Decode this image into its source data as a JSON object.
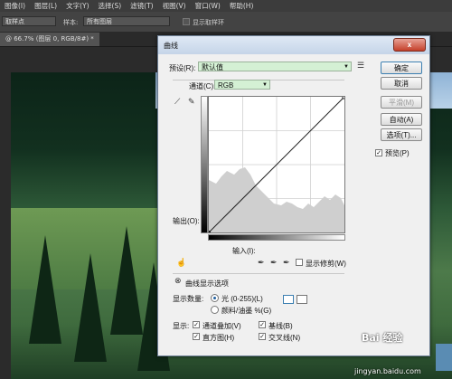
{
  "menu": [
    "图像(I)",
    "图层(L)",
    "文字(Y)",
    "选择(S)",
    "滤镜(T)",
    "视图(V)",
    "窗口(W)",
    "帮助(H)"
  ],
  "options": {
    "tool_select": "取样点",
    "sample_label": "样本:",
    "sample_value": "所有图层",
    "ring_label": "显示取样环"
  },
  "doc_tab": "@ 66.7% (图层 0, RGB/8#) *",
  "dialog": {
    "title": "曲线",
    "close": "x",
    "preset_label": "预设(R):",
    "preset_value": "默认值",
    "channel_label": "通道(C):",
    "channel_value": "RGB",
    "output_label": "输出(O):",
    "input_label": "输入(I):",
    "clip_label": "显示修剪(W)",
    "curve_options_label": "曲线显示选项",
    "show_amount_label": "显示数量:",
    "light_label": "光 (0-255)(L)",
    "pigment_label": "颜料/油墨 %(G)",
    "show_label": "显示:",
    "channel_overlay_label": "通道叠加(V)",
    "baseline_label": "基线(B)",
    "histogram_label": "直方图(H)",
    "intersection_label": "交叉线(N)",
    "buttons": {
      "ok": "确定",
      "cancel": "取消",
      "smooth": "平滑(M)",
      "auto": "自动(A)",
      "options": "选项(T)...",
      "preview": "预览(P)"
    }
  },
  "watermark": "Bai 经验",
  "watermark_url": "jingyan.baidu.com",
  "colors": {
    "combo_bg": "#d4f0d4",
    "title_bar": "#c5d5e8",
    "close": "#c4402a"
  }
}
